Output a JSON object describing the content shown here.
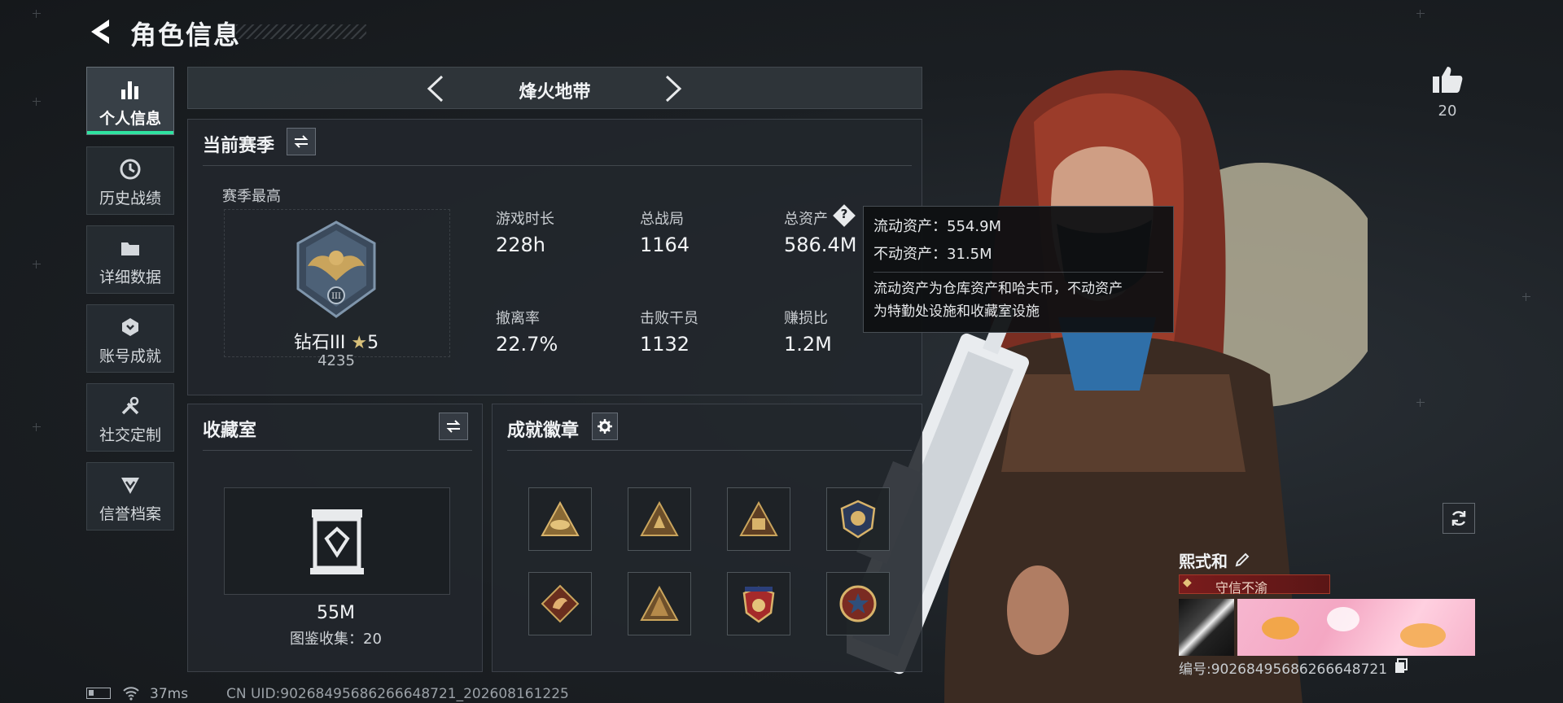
{
  "header": {
    "title": "角色信息"
  },
  "sidebar": {
    "items": [
      {
        "label": "个人信息",
        "icon": "bar-chart-icon",
        "active": true
      },
      {
        "label": "历史战绩",
        "icon": "clock-icon"
      },
      {
        "label": "详细数据",
        "icon": "folder-icon"
      },
      {
        "label": "账号成就",
        "icon": "achievement-icon"
      },
      {
        "label": "社交定制",
        "icon": "tools-icon"
      },
      {
        "label": "信誉档案",
        "icon": "credit-icon"
      }
    ]
  },
  "mode": {
    "title": "烽火地带"
  },
  "season": {
    "title": "当前赛季",
    "best_label": "赛季最高",
    "rank": "钻石III",
    "stars": "5",
    "score": "4235",
    "stats": [
      {
        "label": "游戏时长",
        "value": "228h"
      },
      {
        "label": "总战局",
        "value": "1164"
      },
      {
        "label": "总资产",
        "value": "586.4M"
      },
      {
        "label": "撤离率",
        "value": "22.7%"
      },
      {
        "label": "击败干员",
        "value": "1132"
      },
      {
        "label": "赚损比",
        "value": "1.2M"
      }
    ]
  },
  "tooltip": {
    "liquid": "流动资产：554.9M",
    "fixed": "不动资产：31.5M",
    "desc1": "流动资产为仓库资产和哈夫币，不动资产",
    "desc2": "为特勤处设施和收藏室设施"
  },
  "collection": {
    "title": "收藏室",
    "value": "55M",
    "count": "图鉴收集：20"
  },
  "badges": {
    "title": "成就徽章"
  },
  "like": {
    "count": "20"
  },
  "profile": {
    "name": "熙式和",
    "title": "守信不渝",
    "id": "编号:90268495686266648721"
  },
  "status": {
    "ping": "37ms",
    "uid": "CN UID:90268495686266648721_202608161225"
  },
  "colors": {
    "accent": "#2fe3a0",
    "gold": "#c9a45c",
    "title_red": "#7a1c1c"
  }
}
